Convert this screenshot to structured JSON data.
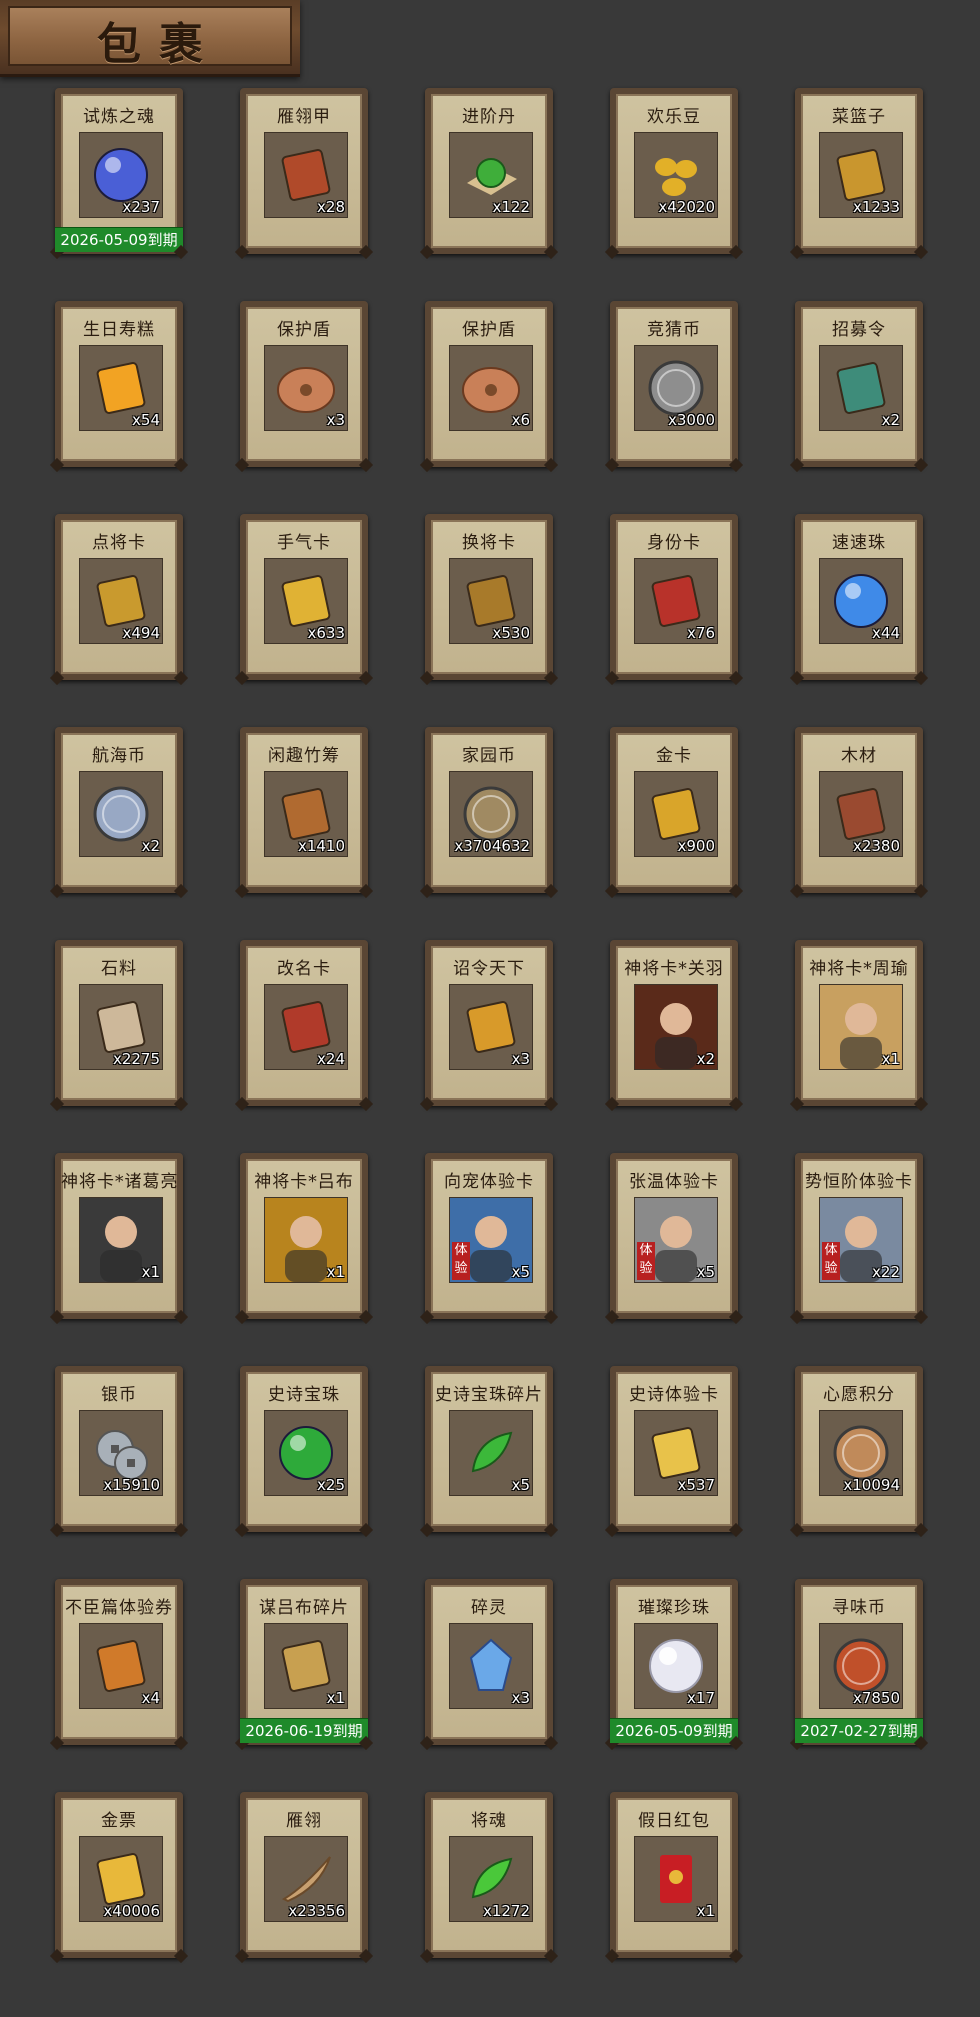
{
  "header": {
    "title": "包裹"
  },
  "items": [
    {
      "name": "试炼之魂",
      "qty": "x237",
      "expiry": "2026-05-09到期",
      "icon": "blue-orb",
      "color": "#4a5fd6"
    },
    {
      "name": "雁翎甲",
      "qty": "x28",
      "expiry": "",
      "icon": "armor",
      "color": "#b04a2a"
    },
    {
      "name": "进阶丹",
      "qty": "x122",
      "expiry": "",
      "icon": "green-pill",
      "color": "#3fae3a"
    },
    {
      "name": "欢乐豆",
      "qty": "x42020",
      "expiry": "",
      "icon": "gold-beans",
      "color": "#e2b028"
    },
    {
      "name": "菜篮子",
      "qty": "x1233",
      "expiry": "",
      "icon": "basket",
      "color": "#c9962e"
    },
    {
      "name": "生日寿糕",
      "qty": "x54",
      "expiry": "",
      "icon": "cake",
      "color": "#f2a323"
    },
    {
      "name": "保护盾",
      "qty": "x3",
      "expiry": "",
      "icon": "shield",
      "color": "#c98058"
    },
    {
      "name": "保护盾",
      "qty": "x6",
      "expiry": "",
      "icon": "shield",
      "color": "#c98058"
    },
    {
      "name": "竞猜币",
      "qty": "x3000",
      "expiry": "",
      "icon": "silver-coin",
      "color": "#8e8e8e"
    },
    {
      "name": "招募令",
      "qty": "x2",
      "expiry": "",
      "icon": "recruit-token",
      "color": "#3e8c7a"
    },
    {
      "name": "点将卡",
      "qty": "x494",
      "expiry": "",
      "icon": "general-card",
      "color": "#c99a2e"
    },
    {
      "name": "手气卡",
      "qty": "x633",
      "expiry": "",
      "icon": "luck-card",
      "color": "#e0b234"
    },
    {
      "name": "换将卡",
      "qty": "x530",
      "expiry": "",
      "icon": "swap-card",
      "color": "#a87a2a"
    },
    {
      "name": "身份卡",
      "qty": "x76",
      "expiry": "",
      "icon": "identity-card",
      "color": "#b8322a"
    },
    {
      "name": "速速珠",
      "qty": "x44",
      "expiry": "",
      "icon": "blue-glow-orb",
      "color": "#3f8ae8"
    },
    {
      "name": "航海币",
      "qty": "x2",
      "expiry": "",
      "icon": "sail-coin",
      "color": "#98a8c4"
    },
    {
      "name": "闲趣竹筹",
      "qty": "x1410",
      "expiry": "",
      "icon": "bamboo-tag",
      "color": "#b06a30"
    },
    {
      "name": "家园币",
      "qty": "x3704632",
      "expiry": "",
      "icon": "home-coin",
      "color": "#a08a62"
    },
    {
      "name": "金卡",
      "qty": "x900",
      "expiry": "",
      "icon": "gold-card",
      "color": "#d9a52a"
    },
    {
      "name": "木材",
      "qty": "x2380",
      "expiry": "",
      "icon": "wood",
      "color": "#9a4a30"
    },
    {
      "name": "石料",
      "qty": "x2275",
      "expiry": "",
      "icon": "stone",
      "color": "#cdb89a"
    },
    {
      "name": "改名卡",
      "qty": "x24",
      "expiry": "",
      "icon": "rename-card",
      "color": "#b03a2a"
    },
    {
      "name": "诏令天下",
      "qty": "x3",
      "expiry": "",
      "icon": "edict-scroll",
      "color": "#d89a2a"
    },
    {
      "name": "神将卡*关羽",
      "qty": "x2",
      "expiry": "",
      "icon": "portrait-guanyu",
      "color": "#5a2a1a"
    },
    {
      "name": "神将卡*周瑜",
      "qty": "x1",
      "expiry": "",
      "icon": "portrait-zhouyu",
      "color": "#c8a060"
    },
    {
      "name": "神将卡*诸葛亮",
      "qty": "x1",
      "expiry": "",
      "icon": "portrait-zhugeliang",
      "color": "#3a3a3a"
    },
    {
      "name": "神将卡*吕布",
      "qty": "x1",
      "expiry": "",
      "icon": "portrait-lvbu",
      "color": "#b8841e"
    },
    {
      "name": "向宠体验卡",
      "qty": "x5",
      "expiry": "",
      "icon": "portrait-xiangchong",
      "color": "#3e6ea8",
      "badge": "体验"
    },
    {
      "name": "张温体验卡",
      "qty": "x5",
      "expiry": "",
      "icon": "portrait-zhangwen",
      "color": "#8a8a8a",
      "badge": "体验"
    },
    {
      "name": "势恒阶体验卡",
      "qty": "x22",
      "expiry": "",
      "icon": "portrait-trial",
      "color": "#7a8aa0",
      "badge": "体验"
    },
    {
      "name": "银币",
      "qty": "x15910",
      "expiry": "",
      "icon": "silver-coins",
      "color": "#a8b0b8"
    },
    {
      "name": "史诗宝珠",
      "qty": "x25",
      "expiry": "",
      "icon": "green-orb",
      "color": "#2eaa3a"
    },
    {
      "name": "史诗宝珠碎片",
      "qty": "x5",
      "expiry": "",
      "icon": "green-shard",
      "color": "#3cb83a"
    },
    {
      "name": "史诗体验卡",
      "qty": "x537",
      "expiry": "",
      "icon": "gold-ticket",
      "color": "#e8c24a"
    },
    {
      "name": "心愿积分",
      "qty": "x10094",
      "expiry": "",
      "icon": "heart-coin",
      "color": "#c08a5a"
    },
    {
      "name": "不臣篇体验券",
      "qty": "x4",
      "expiry": "",
      "icon": "orange-ticket",
      "color": "#d07a2a"
    },
    {
      "name": "谋吕布碎片",
      "qty": "x1",
      "expiry": "2026-06-19到期",
      "icon": "puzzle-piece",
      "color": "#c8a050"
    },
    {
      "name": "碎灵",
      "qty": "x3",
      "expiry": "",
      "icon": "crystal",
      "color": "#6aa8e8"
    },
    {
      "name": "璀璨珍珠",
      "qty": "x17",
      "expiry": "2026-05-09到期",
      "icon": "pearl",
      "color": "#e8e8f2"
    },
    {
      "name": "寻味币",
      "qty": "x7850",
      "expiry": "2027-02-27到期",
      "icon": "flavor-coin",
      "color": "#c0502a"
    },
    {
      "name": "金票",
      "qty": "x40006",
      "expiry": "",
      "icon": "gold-note",
      "color": "#e8b83a"
    },
    {
      "name": "雁翎",
      "qty": "x23356",
      "expiry": "",
      "icon": "feather",
      "color": "#c8a070"
    },
    {
      "name": "将魂",
      "qty": "x1272",
      "expiry": "",
      "icon": "green-spirit",
      "color": "#4ac83a"
    },
    {
      "name": "假日红包",
      "qty": "x1",
      "expiry": "",
      "icon": "red-envelope",
      "color": "#c81e24"
    }
  ]
}
